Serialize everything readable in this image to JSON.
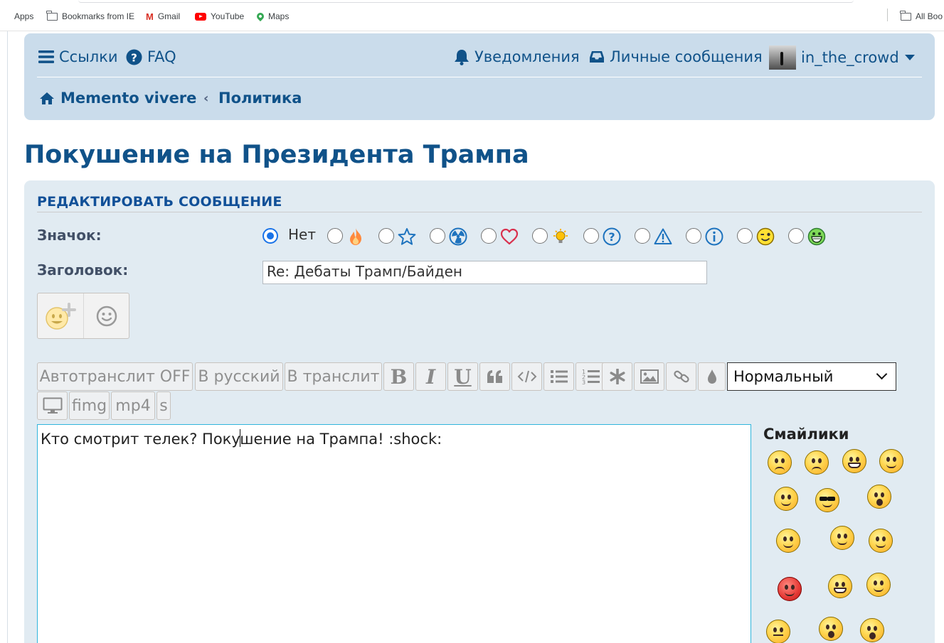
{
  "bookmarks": {
    "items": [
      "Apps",
      "Bookmarks from IE",
      "Gmail",
      "YouTube",
      "Maps"
    ],
    "all_bookmarks": "All Boo"
  },
  "header": {
    "links_label": "Ссылки",
    "faq_label": "FAQ",
    "notifications_label": "Уведомления",
    "messages_label": "Личные сообщения",
    "username": "in_the_crowd",
    "breadcrumb": [
      "Memento vivere",
      "Политика"
    ]
  },
  "page": {
    "title": "Покушение на Президента Трампа"
  },
  "form": {
    "heading": "РЕДАКТИРОВАТЬ СООБЩЕНИЕ",
    "icon_label": "Значок:",
    "no_icon_label": "Нет",
    "topic_icons": [
      "fire-icon",
      "star-icon",
      "radioactive-icon",
      "heart-icon",
      "lightbulb-icon",
      "question-icon",
      "warning-icon",
      "info-icon",
      "wink-smiley-icon",
      "grin-smiley-icon"
    ],
    "subject_label": "Заголовок:",
    "subject_value": "Re: Дебаты Трамп/Байден",
    "message_before_cursor": "Кто смотрит телек? Поку",
    "message_after_cursor": "шение на Трампа! :shock:"
  },
  "toolbar": {
    "translit_off": "Автотранслит OFF",
    "to_russian": "В русский",
    "to_translit": "В транслит",
    "bold": "B",
    "italic": "I",
    "underline": "U",
    "font_size_selected": "Нормальный",
    "fimg": "fimg",
    "mp4": "mp4",
    "s": "s"
  },
  "smilies": {
    "title": "Смайлики"
  },
  "colors": {
    "header_bg": "#cadceb",
    "panel_bg": "#e1ebf2",
    "link": "#105289",
    "radio_selected": "#1a73e8"
  }
}
